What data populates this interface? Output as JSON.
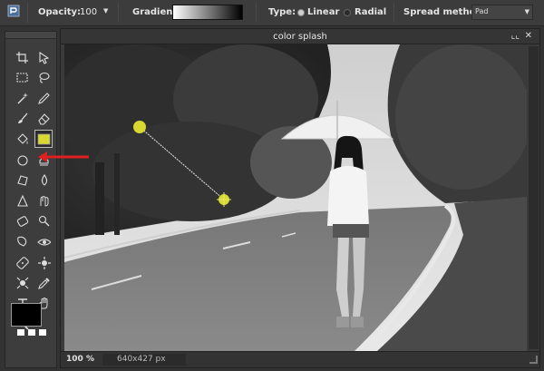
{
  "options_bar": {
    "opacity_label": "Opacity:",
    "opacity_value": "100",
    "gradient_label": "Gradient:",
    "type_label": "Type:",
    "type_linear": "Linear",
    "type_radial": "Radial",
    "type_selected": "Linear",
    "spread_label": "Spread method:",
    "spread_value": "Pad"
  },
  "document": {
    "title": "color splash",
    "zoom": "100",
    "zoom_unit": "%",
    "dimensions": "640x427 px"
  },
  "tools": [
    "crop-tool-icon",
    "move-tool-icon",
    "marquee-tool-icon",
    "lasso-tool-icon",
    "magic-wand-icon",
    "pencil-icon",
    "brush-icon",
    "eraser-icon",
    "paint-bucket-icon",
    "gradient-tool-icon",
    "color-picker-icon",
    "clone-stamp-icon",
    "shape-tool-icon",
    "blur-icon",
    "sharpen-icon",
    "smudge-icon",
    "sponge-icon",
    "dodge-icon",
    "burn-icon",
    "red-eye-icon",
    "spot-heal-icon",
    "bloat-icon",
    "pinch-icon",
    "eyedropper-icon",
    "text-tool-icon",
    "hand-tool-icon",
    "zoom-tool-icon"
  ],
  "active_tool": "gradient-tool-icon",
  "colors": {
    "primary": "#000000",
    "accent_yellow": "#d8d830",
    "annotation_red": "#e02020"
  }
}
